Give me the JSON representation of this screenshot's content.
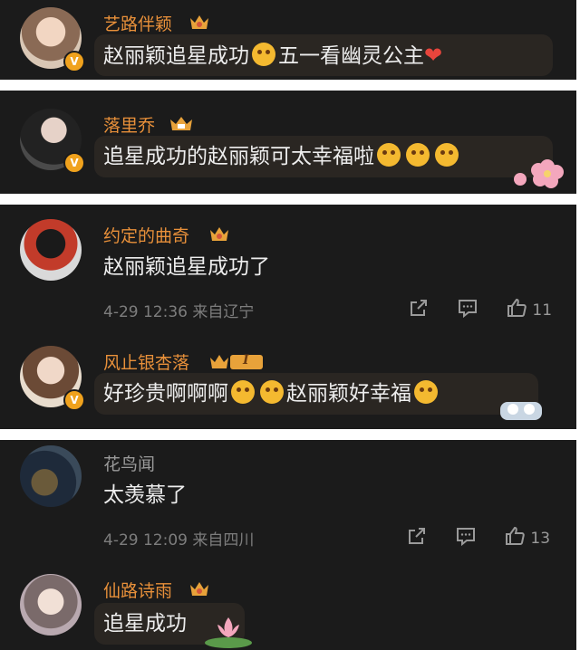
{
  "comments": [
    {
      "username": "艺路伴颖",
      "text": "赵丽颖追星成功",
      "text2": "五一看幽灵公主"
    },
    {
      "username": "落里乔",
      "text": "追星成功的赵丽颖可太幸福啦"
    },
    {
      "username": "约定的曲奇",
      "text": "赵丽颖追星成功了",
      "meta": "4-29 12:36 来自辽宁",
      "like_count": "11"
    },
    {
      "username": "风止银杏落",
      "badge_level": "I",
      "text": "好珍贵啊啊啊",
      "text2": "赵丽颖好幸福"
    },
    {
      "username": "花鸟闻",
      "text": "太羡慕了",
      "meta": "4-29 12:09 来自四川",
      "like_count": "13"
    },
    {
      "username": "仙路诗雨",
      "text": "追星成功"
    }
  ],
  "colors": {
    "background": "#1b1b1b",
    "username": "#e8903a",
    "username_plain": "#9a9a9a",
    "text": "#ededed",
    "meta": "#7d7d7d",
    "verified_badge": "#f0a21d",
    "crown": "#e8a23a"
  },
  "icons": [
    "crown-icon",
    "verified-icon",
    "share-icon",
    "comment-icon",
    "like-icon",
    "heart-emoji",
    "smiley-emoji",
    "flower-decoration"
  ]
}
